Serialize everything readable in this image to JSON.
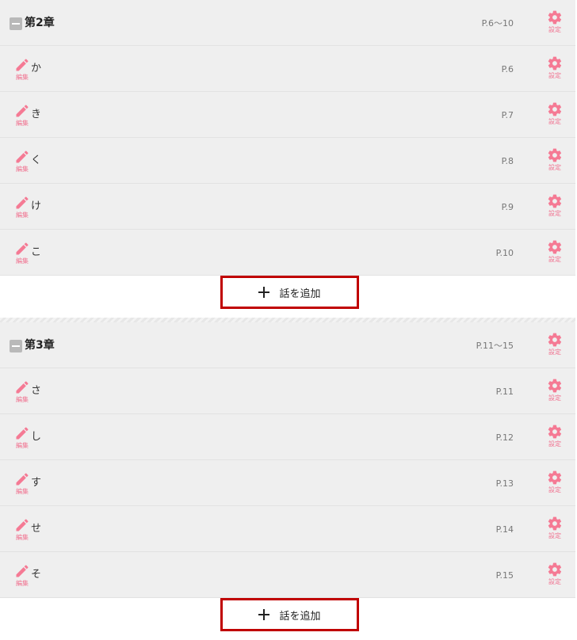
{
  "icon_color": "#f57a94",
  "accent_border_color": "#c00000",
  "edit_caption": "編集",
  "gear_caption": "設定",
  "chapters": [
    {
      "title": "第2章",
      "pages": "P.6～10",
      "episodes": [
        {
          "title": "か",
          "page": "P.6"
        },
        {
          "title": "き",
          "page": "P.7"
        },
        {
          "title": "く",
          "page": "P.8"
        },
        {
          "title": "け",
          "page": "P.9"
        },
        {
          "title": "こ",
          "page": "P.10"
        }
      ],
      "add_label": "話を追加"
    },
    {
      "title": "第3章",
      "pages": "P.11～15",
      "episodes": [
        {
          "title": "さ",
          "page": "P.11"
        },
        {
          "title": "し",
          "page": "P.12"
        },
        {
          "title": "す",
          "page": "P.13"
        },
        {
          "title": "せ",
          "page": "P.14"
        },
        {
          "title": "そ",
          "page": "P.15"
        }
      ],
      "add_label": "話を追加"
    }
  ]
}
